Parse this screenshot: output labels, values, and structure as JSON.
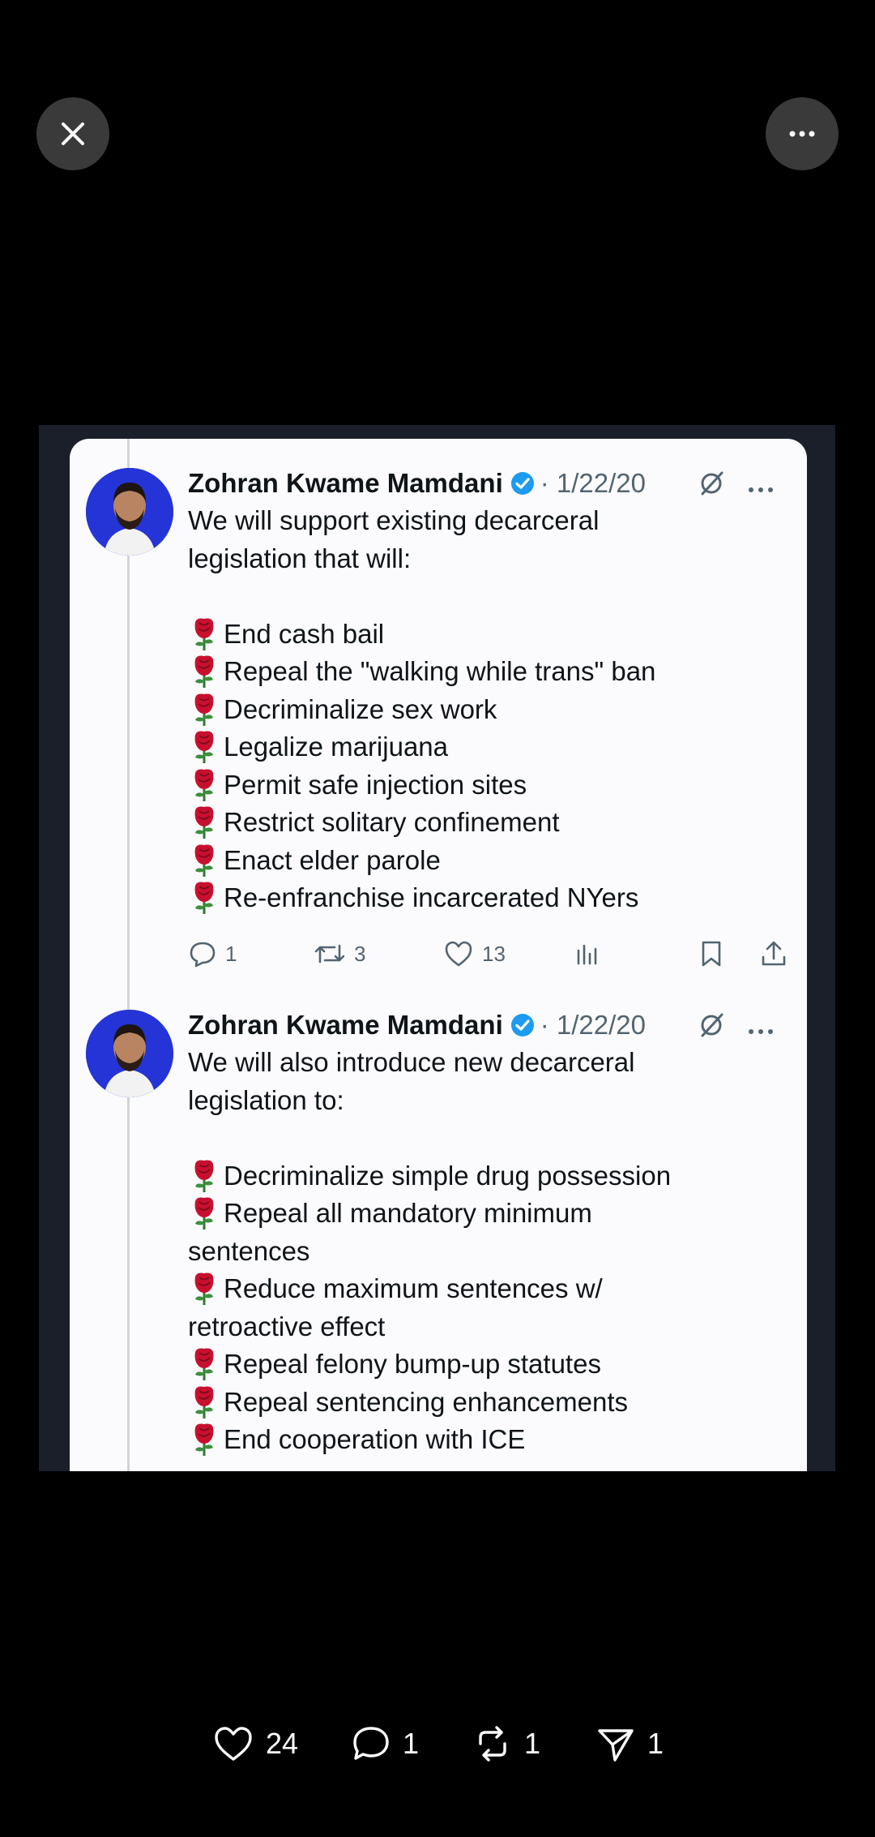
{
  "viewer": {
    "close_icon": "close-icon",
    "more_icon": "more-horizontal-icon"
  },
  "tweets": [
    {
      "author": "Zohran Kwame Mamdani",
      "date": "· 1/22/20",
      "intro": [
        "We will support existing decarceral",
        "legislation that will:"
      ],
      "items": [
        [
          "End cash bail"
        ],
        [
          "Repeal the \"walking while trans\" ban"
        ],
        [
          "Decriminalize sex work"
        ],
        [
          "Legalize marijuana"
        ],
        [
          "Permit safe injection sites"
        ],
        [
          "Restrict solitary confinement"
        ],
        [
          "Enact elder parole"
        ],
        [
          "Re-enfranchise incarcerated NYers"
        ]
      ],
      "actions": {
        "replies": "1",
        "retweets": "3",
        "likes": "13"
      }
    },
    {
      "author": "Zohran Kwame Mamdani",
      "date": "· 1/22/20",
      "intro": [
        "We will also introduce new decarceral",
        "legislation to:"
      ],
      "items": [
        [
          "Decriminalize simple drug possession"
        ],
        [
          "Repeal all mandatory minimum",
          "sentences"
        ],
        [
          "Reduce maximum sentences w/",
          "retroactive effect"
        ],
        [
          "Repeal felony bump-up statutes"
        ],
        [
          "Repeal sentencing enhancements"
        ],
        [
          "End cooperation with ICE"
        ]
      ]
    }
  ],
  "bottom_bar": {
    "likes": "24",
    "comments": "1",
    "reposts": "1",
    "shares": "1"
  },
  "colors": {
    "background": "#000000",
    "card": "#fbfbfd",
    "verified": "#1d9bf0",
    "secondary_text": "#536471",
    "avatar_bg": "#2434d6",
    "rose": "#c8102e"
  }
}
